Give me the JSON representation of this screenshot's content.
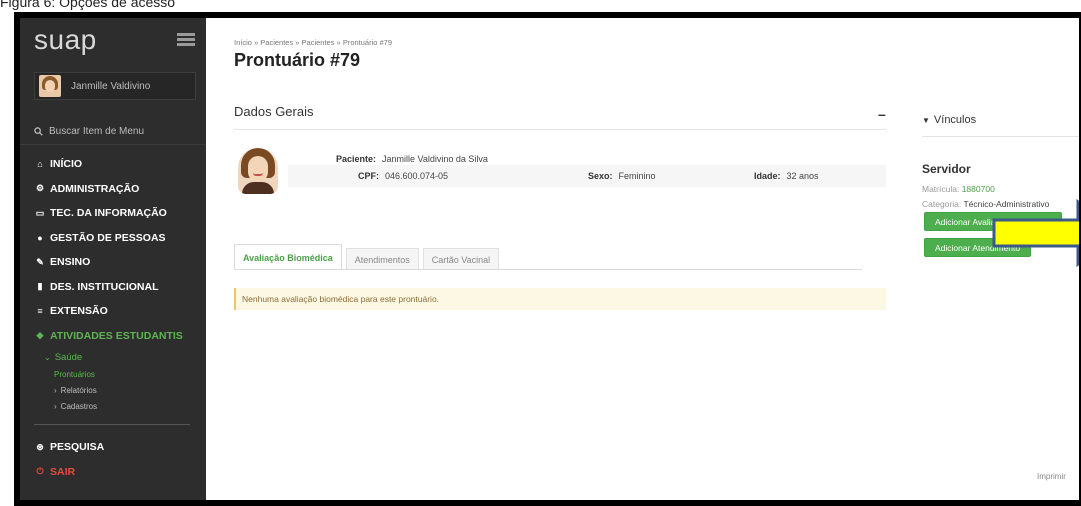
{
  "caption": "Figura 6: Opções de acesso",
  "sidebar": {
    "logo": "suap",
    "user_name": "Janmille Valdivino",
    "search_placeholder": "Buscar Item de Menu",
    "items": [
      {
        "label": "INÍCIO",
        "icon": "home-icon",
        "glyph": "⌂"
      },
      {
        "label": "ADMINISTRAÇÃO",
        "icon": "gears-icon",
        "glyph": "⚙"
      },
      {
        "label": "TEC. DA INFORMAÇÃO",
        "icon": "monitor-icon",
        "glyph": "▭"
      },
      {
        "label": "GESTÃO DE PESSOAS",
        "icon": "user-icon",
        "glyph": "●"
      },
      {
        "label": "ENSINO",
        "icon": "pencil-icon",
        "glyph": "✎"
      },
      {
        "label": "DES. INSTITUCIONAL",
        "icon": "bar-chart-icon",
        "glyph": "▮"
      },
      {
        "label": "EXTENSÃO",
        "icon": "bars-icon",
        "glyph": "≡"
      },
      {
        "label": "ATIVIDADES ESTUDANTIS",
        "icon": "graduation-cap-icon",
        "glyph": "◆"
      }
    ],
    "submenu_saude": "Saúde",
    "submenu_items": {
      "prontuarios": "Prontuários",
      "relatorios": "Relatórios",
      "cadastros": "Cadastros"
    },
    "pesquisa": "PESQUISA",
    "sair": "SAIR"
  },
  "main": {
    "breadcrumb": "Início » Pacientes » Pacientes » Prontuário #79",
    "title": "Prontuário #79",
    "section_title": "Dados Gerais",
    "collapse": "–",
    "patient": {
      "paciente_label": "Paciente:",
      "paciente_value": "Janmille Valdivino da Silva",
      "cpf_label": "CPF:",
      "cpf_value": "046.600.074-05",
      "sexo_label": "Sexo:",
      "sexo_value": "Feminino",
      "idade_label": "Idade:",
      "idade_value": "32 anos"
    },
    "tabs": [
      "Avaliação Biomédica",
      "Atendimentos",
      "Cartão Vacinal"
    ],
    "alert": "Nenhuma avaliação biomédica para este prontuário.",
    "print": "Imprimir"
  },
  "right": {
    "vinculos": "Vínculos",
    "servidor": "Servidor",
    "matricula_label": "Matrícula:",
    "matricula_value": "1880700",
    "categoria_label": "Categoria:",
    "categoria_value": "Técnico-Administrativo",
    "btn_avaliacao": "Adicionar Avaliação Biomédica",
    "btn_atendimento": "Adicionar Atendimento"
  },
  "colors": {
    "sidebar_bg": "#2d2d2d",
    "accent_green": "#4cae4c",
    "arrow_fill": "#ffff00",
    "arrow_stroke": "#3b5a8a"
  }
}
